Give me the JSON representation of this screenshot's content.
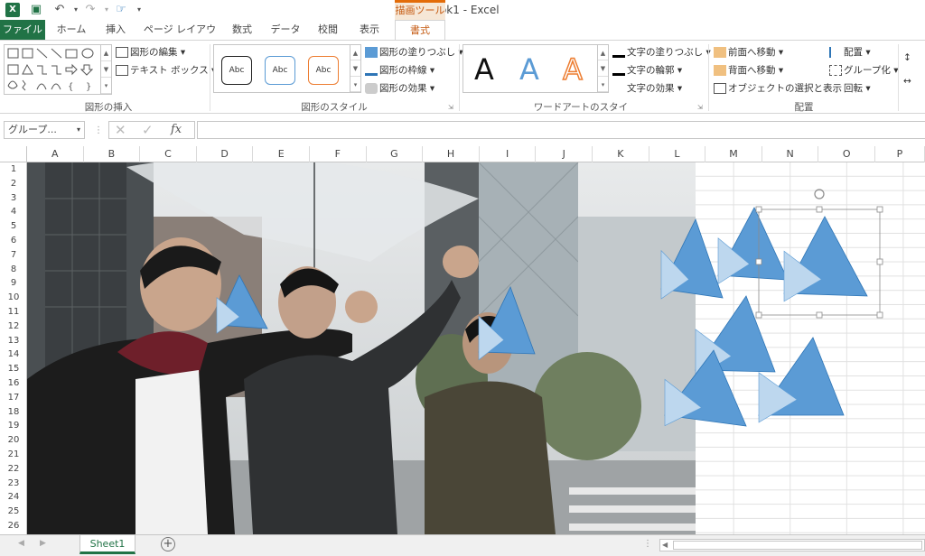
{
  "titlebar": {
    "title": "Book1 - Excel",
    "context_tab": "描画ツール",
    "icons": [
      "excel-app-icon",
      "save-icon",
      "undo-icon",
      "redo-icon",
      "touch-mode-icon",
      "customize-qat-icon"
    ]
  },
  "tabs": [
    {
      "label": "ファイル"
    },
    {
      "label": "ホーム"
    },
    {
      "label": "挿入"
    },
    {
      "label": "ページ レイアウト"
    },
    {
      "label": "数式"
    },
    {
      "label": "データ"
    },
    {
      "label": "校閲"
    },
    {
      "label": "表示"
    },
    {
      "label": "書式"
    }
  ],
  "ribbon": {
    "insert_shapes": {
      "label": "図形の挿入",
      "edit_shape": "図形の編集",
      "text_box": "テキスト ボックス"
    },
    "shape_styles": {
      "label": "図形のスタイル",
      "preset_text": "Abc",
      "fill": "図形の塗りつぶし",
      "outline": "図形の枠線",
      "effects": "図形の効果"
    },
    "wordart_styles": {
      "label": "ワードアートのスタイル",
      "letter": "A",
      "text_fill": "文字の塗りつぶし",
      "text_outline": "文字の輪郭",
      "text_effects": "文字の効果"
    },
    "arrange": {
      "label": "配置",
      "bring_forward": "前面へ移動",
      "send_backward": "背面へ移動",
      "selection_pane": "オブジェクトの選択と表示",
      "align": "配置",
      "group": "グループ化",
      "rotate": "回転"
    }
  },
  "formula_bar": {
    "name_box": "グループ...",
    "formula": ""
  },
  "columns": [
    "A",
    "B",
    "C",
    "D",
    "E",
    "F",
    "G",
    "H",
    "I",
    "J",
    "K",
    "L",
    "M",
    "N",
    "O",
    "P"
  ],
  "rows": [
    "1",
    "2",
    "3",
    "4",
    "5",
    "6",
    "7",
    "8",
    "9",
    "10",
    "11",
    "12",
    "13",
    "14",
    "15",
    "16",
    "17",
    "18",
    "19",
    "20",
    "21",
    "22",
    "23",
    "24",
    "25",
    "26"
  ],
  "sheet_tabs": [
    {
      "label": "Sheet1",
      "active": true
    }
  ],
  "colors": {
    "excel_green": "#217346",
    "accent_orange": "#c55a11",
    "shape_dark_blue": "#5b9bd5",
    "shape_light_blue": "#bdd7ee"
  }
}
